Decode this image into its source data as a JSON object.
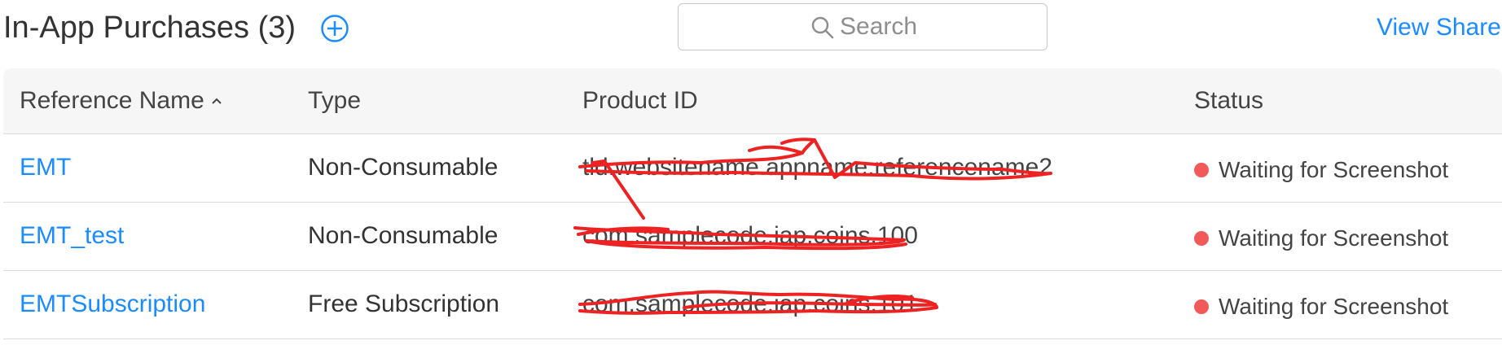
{
  "header": {
    "title": "In-App Purchases (3)",
    "add_icon": "plus-circle-icon",
    "search_placeholder": "Search",
    "search_icon": "search-icon",
    "view_shared_label": "View Shared"
  },
  "table": {
    "columns": [
      "Reference Name",
      "Type",
      "Product ID",
      "Status"
    ],
    "sort_icon": "chevron-up-icon",
    "rows": [
      {
        "name": "EMT",
        "type": "Non-Consumable",
        "product_id": "tld.websitename.appname.referencename2",
        "status": "Waiting for Screenshot"
      },
      {
        "name": "EMT_test",
        "type": "Non-Consumable",
        "product_id": "com.samplecode.iap.coins.100",
        "status": "Waiting for Screenshot"
      },
      {
        "name": "EMTSubscription",
        "type": "Free Subscription",
        "product_id": "com.samplecode.iap.coins.101",
        "status": "Waiting for Screenshot"
      }
    ]
  },
  "colors": {
    "accent": "#1a8cff",
    "status_dot": "#f25a5a",
    "redaction": "#ee2222",
    "header_bg": "#f6f6f6"
  }
}
